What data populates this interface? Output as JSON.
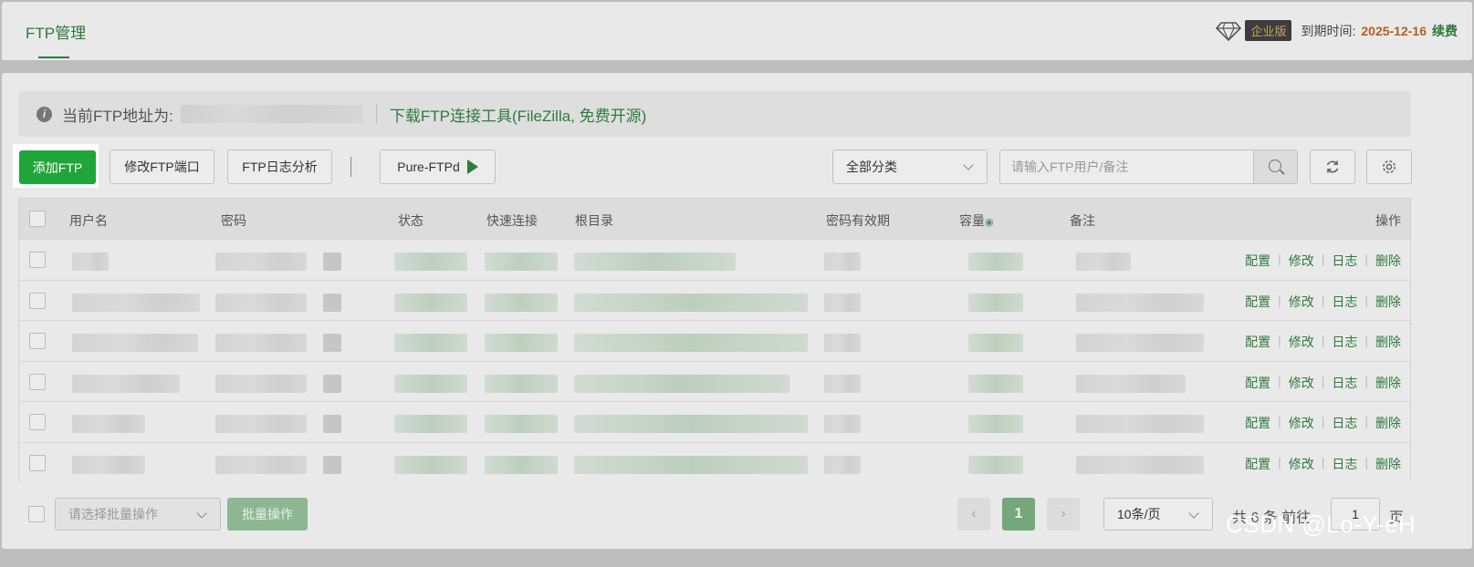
{
  "header": {
    "tab_title": "FTP管理",
    "edition_badge": "企业版",
    "expire_label": "到期时间:",
    "expire_date": "2025-12-16",
    "renew_label": "续费"
  },
  "notice": {
    "address_label": "当前FTP地址为:",
    "download_link": "下载FTP连接工具(FileZilla, 免费开源)"
  },
  "toolbar": {
    "add_label": "添加FTP",
    "port_label": "修改FTP端口",
    "log_label": "FTP日志分析",
    "pure_label": "Pure-FTPd",
    "category_value": "全部分类",
    "search_placeholder": "请输入FTP用户/备注"
  },
  "table": {
    "headers": {
      "username": "用户名",
      "password": "密码",
      "status": "状态",
      "quick": "快速连接",
      "root": "根目录",
      "expiry": "密码有效期",
      "capacity": "容量",
      "remark": "备注",
      "actions": "操作"
    },
    "row_actions": {
      "config": "配置",
      "edit": "修改",
      "log": "日志",
      "delete": "删除"
    }
  },
  "footer": {
    "batch_placeholder": "请选择批量操作",
    "batch_button": "批量操作",
    "current_page": "1",
    "page_size": "10条/页",
    "total_text": "共 6 条  前往",
    "goto_value": "1",
    "page_unit": "页"
  },
  "watermark": "CSDN @Lo-Y-eH",
  "colors": {
    "accent": "#20a53a",
    "expire": "#b85c23"
  }
}
